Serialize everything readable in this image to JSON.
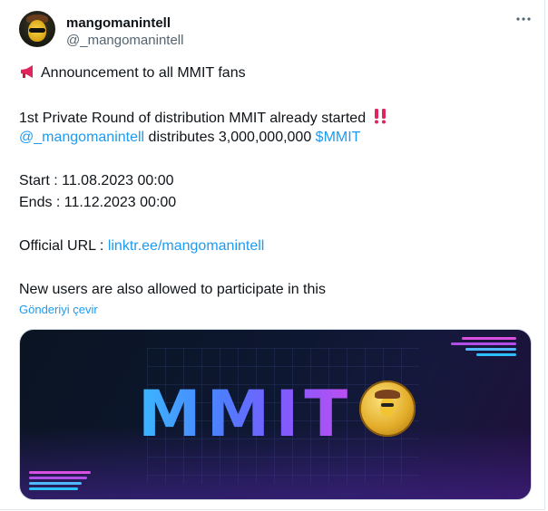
{
  "header": {
    "display_name": "mangomanintell",
    "handle": "@_mangomanintell",
    "more_icon": "more-horizontal-icon"
  },
  "tweet": {
    "line1_icon": "megaphone-icon",
    "line1": "Announcement to all MMIT fans",
    "line2": "1st Private Round of distribution MMIT already started",
    "line2_icon": "double-exclamation-icon",
    "line3_mention": "@_mangomanintell",
    "line3_text": " distributes 3,000,000,000 ",
    "line3_cashtag": "$MMIT",
    "start": "Start : 11.08.2023 00:00",
    "ends": "Ends : 11.12.2023 00:00",
    "url_label": "Official URL : ",
    "url_link": "linktr.ee/mangomanintell",
    "last_line": "New users are also allowed to participate in this"
  },
  "translate_label": "Gönderiyi çevir",
  "media": {
    "logo_text": "MMIT",
    "colors": {
      "logo_start": "#3ab8ff",
      "logo_end": "#c04ef0",
      "link": "#1d9bf0"
    }
  }
}
